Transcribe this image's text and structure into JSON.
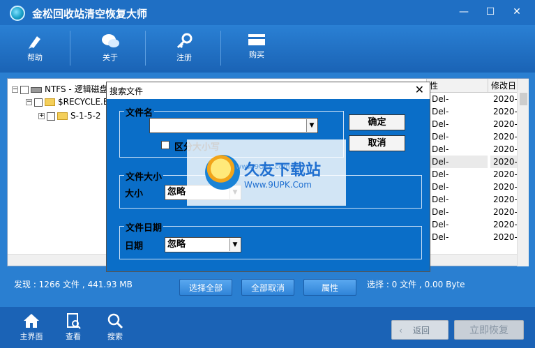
{
  "window": {
    "title": "金松回收站清空恢复大师",
    "controls": {
      "minimize": "—",
      "maximize": "☐",
      "close": "✕"
    }
  },
  "toolbar": {
    "items": [
      {
        "label": "帮助",
        "icon": "pen-icon"
      },
      {
        "label": "关于",
        "icon": "chat-bubbles-icon"
      },
      {
        "label": "注册",
        "icon": "key-icon"
      },
      {
        "label": "购买",
        "icon": "card-icon"
      }
    ]
  },
  "tree": {
    "rows": [
      {
        "expander": "−",
        "label": "NTFS - 逻辑磁盘"
      },
      {
        "expander": "−",
        "label": "$RECYCLE.BIN"
      },
      {
        "expander": "+",
        "label": "S-1-5-2"
      }
    ]
  },
  "list": {
    "columns": [
      "性",
      "修改日"
    ],
    "attr_values": [
      "Del-",
      "Del-",
      "Del-",
      "Del-",
      "Del-",
      "Del-",
      "Del-",
      "Del-",
      "Del-",
      "Del-",
      "Del-",
      "Del-"
    ],
    "date_values": [
      "2020-",
      "2020-",
      "2020-",
      "2020-",
      "2020-",
      "2020-",
      "2020-",
      "2020-",
      "2020-",
      "2020-",
      "2020-",
      "2020-"
    ]
  },
  "status": {
    "found": "发现 : 1266 文件 , 441.93 MB",
    "selected": "选择 : 0 文件 , 0.00 Byte"
  },
  "actions": {
    "select_all": "选择全部",
    "deselect_all": "全部取消",
    "properties": "属性"
  },
  "bottom_nav": {
    "items": [
      {
        "label": "主界面",
        "icon": "home-icon"
      },
      {
        "label": "查看",
        "icon": "view-icon"
      },
      {
        "label": "搜索",
        "icon": "search-icon"
      }
    ],
    "back": "返回",
    "recover": "立即恢复"
  },
  "dialog": {
    "title": "搜索文件",
    "filename_group": "文件名",
    "filename_value": "",
    "case_sensitive": "区分大小写",
    "ok": "确定",
    "cancel": "取消",
    "size_group": "文件大小",
    "size_label": "大小",
    "size_value": "忽略",
    "date_group": "文件日期",
    "date_label": "日期",
    "date_value": "忽略"
  },
  "watermark": {
    "title": "久友下载站",
    "url": "Www.9UPK.Com",
    "small": "www.9UPK.com"
  }
}
